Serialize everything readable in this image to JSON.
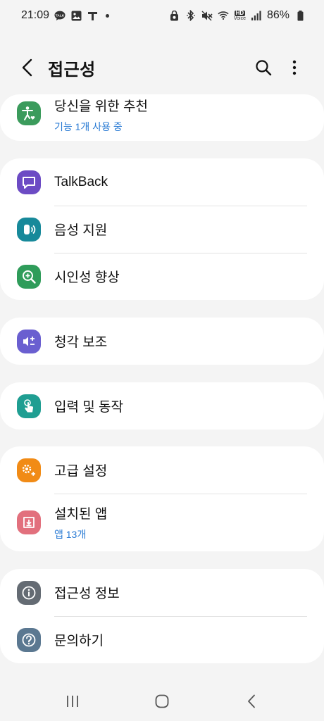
{
  "status": {
    "time": "21:09",
    "battery": "86%",
    "talk_badge": "TALK",
    "hd_badge": "HD",
    "voice_badge": "Voice"
  },
  "header": {
    "title": "접근성"
  },
  "cards": [
    {
      "items": [
        {
          "label": "당신을 위한 추천",
          "sub": "기능 1개 사용 중",
          "color": "#3b9b5c",
          "icon": "accessibility-person-icon"
        }
      ]
    },
    {
      "items": [
        {
          "label": "TalkBack",
          "color": "#6c4bc4",
          "icon": "chat-bubble-icon"
        },
        {
          "label": "음성 지원",
          "color": "#17899a",
          "icon": "voice-assist-icon"
        },
        {
          "label": "시인성 향상",
          "color": "#2f9c5a",
          "icon": "magnifier-plus-icon"
        }
      ]
    },
    {
      "items": [
        {
          "label": "청각 보조",
          "color": "#6a5fd0",
          "icon": "volume-adjust-icon"
        }
      ]
    },
    {
      "items": [
        {
          "label": "입력 및 동작",
          "color": "#1f9e92",
          "icon": "touch-finger-icon"
        }
      ]
    },
    {
      "items": [
        {
          "label": "고급 설정",
          "color": "#f18b16",
          "icon": "gears-plus-icon"
        },
        {
          "label": "설치된 앱",
          "sub": "앱 13개",
          "color": "#e2707d",
          "icon": "download-box-icon"
        }
      ]
    },
    {
      "items": [
        {
          "label": "접근성 정보",
          "color": "#646b73",
          "icon": "info-icon"
        },
        {
          "label": "문의하기",
          "color": "#5b7891",
          "icon": "question-icon"
        }
      ]
    }
  ]
}
